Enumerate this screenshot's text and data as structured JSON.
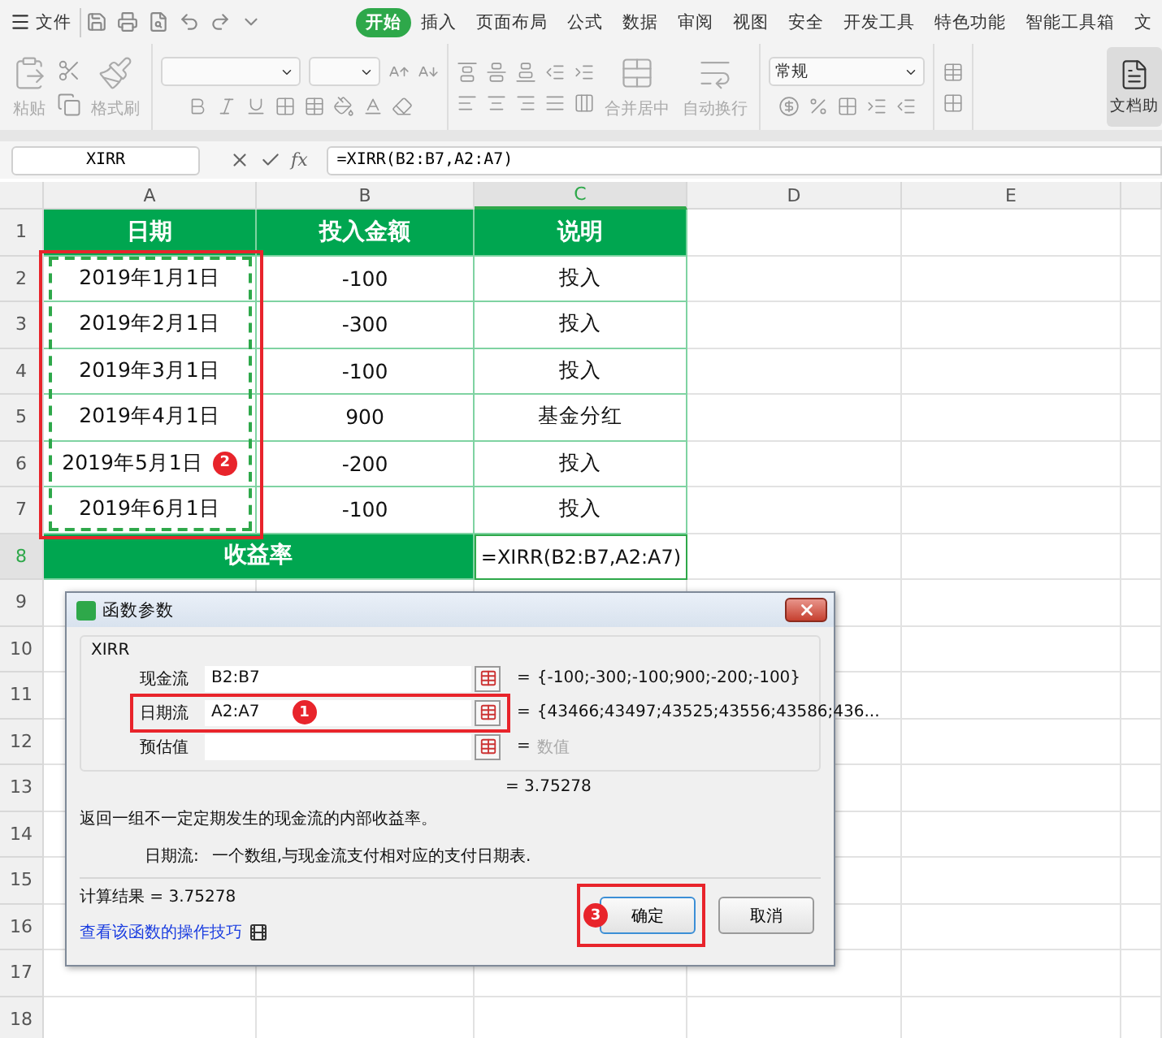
{
  "menu": {
    "file": "文件",
    "tabs": [
      {
        "label": "开始",
        "selected": true
      },
      {
        "label": "插入",
        "selected": false
      },
      {
        "label": "页面布局",
        "selected": false
      },
      {
        "label": "公式",
        "selected": false
      },
      {
        "label": "数据",
        "selected": false
      },
      {
        "label": "审阅",
        "selected": false
      },
      {
        "label": "视图",
        "selected": false
      },
      {
        "label": "安全",
        "selected": false
      },
      {
        "label": "开发工具",
        "selected": false
      },
      {
        "label": "特色功能",
        "selected": false
      },
      {
        "label": "智能工具箱",
        "selected": false
      },
      {
        "label": "文",
        "selected": false
      }
    ]
  },
  "ribbon": {
    "paste": "粘贴",
    "format_painter": "格式刷",
    "merge": "合并居中",
    "wrap": "自动换行",
    "number_format": "常规",
    "doc_helper": "文档助"
  },
  "formula_bar": {
    "name_box": "XIRR",
    "fx": "fx",
    "formula": "=XIRR(B2:B7,A2:A7)"
  },
  "sheet": {
    "reference_marquee": true,
    "columns": [
      {
        "label": "A",
        "selected": false
      },
      {
        "label": "B",
        "selected": false
      },
      {
        "label": "C",
        "selected": true
      },
      {
        "label": "D",
        "selected": false
      },
      {
        "label": "E",
        "selected": false
      }
    ],
    "rows": [
      {
        "number": "1",
        "selected": false,
        "cells": [
          {
            "text": "日期",
            "kind": "header"
          },
          {
            "text": "投入金额",
            "kind": "header"
          },
          {
            "text": "说明",
            "kind": "header"
          }
        ]
      },
      {
        "number": "2",
        "selected": false,
        "cells": [
          {
            "text": "2019年1月1日",
            "kind": "data"
          },
          {
            "text": "-100",
            "kind": "data"
          },
          {
            "text": "投入",
            "kind": "data"
          }
        ]
      },
      {
        "number": "3",
        "selected": false,
        "cells": [
          {
            "text": "2019年2月1日",
            "kind": "data"
          },
          {
            "text": "-300",
            "kind": "data"
          },
          {
            "text": "投入",
            "kind": "data"
          }
        ]
      },
      {
        "number": "4",
        "selected": false,
        "cells": [
          {
            "text": "2019年3月1日",
            "kind": "data"
          },
          {
            "text": "-100",
            "kind": "data"
          },
          {
            "text": "投入",
            "kind": "data"
          }
        ]
      },
      {
        "number": "5",
        "selected": false,
        "cells": [
          {
            "text": "2019年4月1日",
            "kind": "data"
          },
          {
            "text": "900",
            "kind": "data"
          },
          {
            "text": "基金分红",
            "kind": "data"
          }
        ]
      },
      {
        "number": "6",
        "selected": false,
        "cells": [
          {
            "text": "2019年5月1日",
            "kind": "data",
            "badge": "2"
          },
          {
            "text": "-200",
            "kind": "data"
          },
          {
            "text": "投入",
            "kind": "data"
          }
        ]
      },
      {
        "number": "7",
        "selected": false,
        "cells": [
          {
            "text": "2019年6月1日",
            "kind": "data"
          },
          {
            "text": "-100",
            "kind": "data"
          },
          {
            "text": "投入",
            "kind": "data"
          }
        ]
      },
      {
        "number": "8",
        "selected": true,
        "cells": [
          {
            "text": "收益率",
            "kind": "total"
          },
          {
            "text": "=XIRR(B2:B7,A2:A7)",
            "kind": "formula"
          }
        ]
      },
      {
        "number": "9",
        "selected": false
      },
      {
        "number": "10",
        "selected": false
      },
      {
        "number": "11",
        "selected": false
      },
      {
        "number": "12",
        "selected": false
      },
      {
        "number": "13",
        "selected": false
      },
      {
        "number": "14",
        "selected": false
      },
      {
        "number": "15",
        "selected": false
      },
      {
        "number": "16",
        "selected": false
      },
      {
        "number": "17",
        "selected": false
      },
      {
        "number": "18",
        "selected": false
      }
    ]
  },
  "dialog": {
    "title": "函数参数",
    "group": "XIRR",
    "fields": [
      {
        "label": "现金流",
        "value": "B2:B7",
        "eq": "=",
        "result": "{-100;-300;-100;900;-200;-100}",
        "dim": false,
        "highlighted": false
      },
      {
        "label": "日期流",
        "value": "A2:A7",
        "eq": "=",
        "result": "{43466;43497;43525;43556;43586;436...",
        "dim": false,
        "badge": "1",
        "highlighted": true
      },
      {
        "label": "预估值",
        "eq": "=",
        "result": "数值",
        "dim": true,
        "highlighted": false
      }
    ],
    "result": "= 3.75278",
    "description": "返回一组不一定定期发生的现金流的内部收益率。",
    "help_label": "日期流:",
    "help_text": "一个数组,与现金流支付相对应的支付日期表.",
    "calc": "计算结果 = 3.75278",
    "link": "查看该函数的操作技巧",
    "buttons": [
      {
        "label": "确定",
        "kind": "primary",
        "badge": "3",
        "highlighted": true
      },
      {
        "label": "取消",
        "kind": "normal",
        "highlighted": false
      }
    ]
  }
}
